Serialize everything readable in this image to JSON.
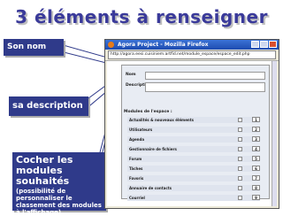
{
  "slide": {
    "title": "3 éléments à renseigner",
    "callouts": {
      "name": "Son nom",
      "description": "sa description",
      "modules_big": "Cocher les modules souhaités",
      "modules_small": "(possibilité de personnaliser le classement des modules à l'affichage)"
    },
    "colors": {
      "title": "#3a3a9a",
      "callout_bg": "#2f3a8a"
    }
  },
  "browser": {
    "window_title": "Agora Project - Mozilla Firefox",
    "url": "http://agora.eesi.cuisiniem.artfid.net/module_espace/espace_edit.php",
    "form": {
      "name_label": "Nom",
      "description_label": "Description",
      "modules_title": "Modules de l'espace :",
      "modules": [
        {
          "name": "Actualités & nouveaux éléments",
          "order": "1"
        },
        {
          "name": "Utilisateurs",
          "order": "2"
        },
        {
          "name": "Agenda",
          "order": "3"
        },
        {
          "name": "Gestionnaire de fichiers",
          "order": "4"
        },
        {
          "name": "Forum",
          "order": "5"
        },
        {
          "name": "Tâches",
          "order": "6"
        },
        {
          "name": "Favoris",
          "order": "7"
        },
        {
          "name": "Annuaire de contacts",
          "order": "8"
        },
        {
          "name": "Courriel",
          "order": "9"
        }
      ]
    }
  }
}
